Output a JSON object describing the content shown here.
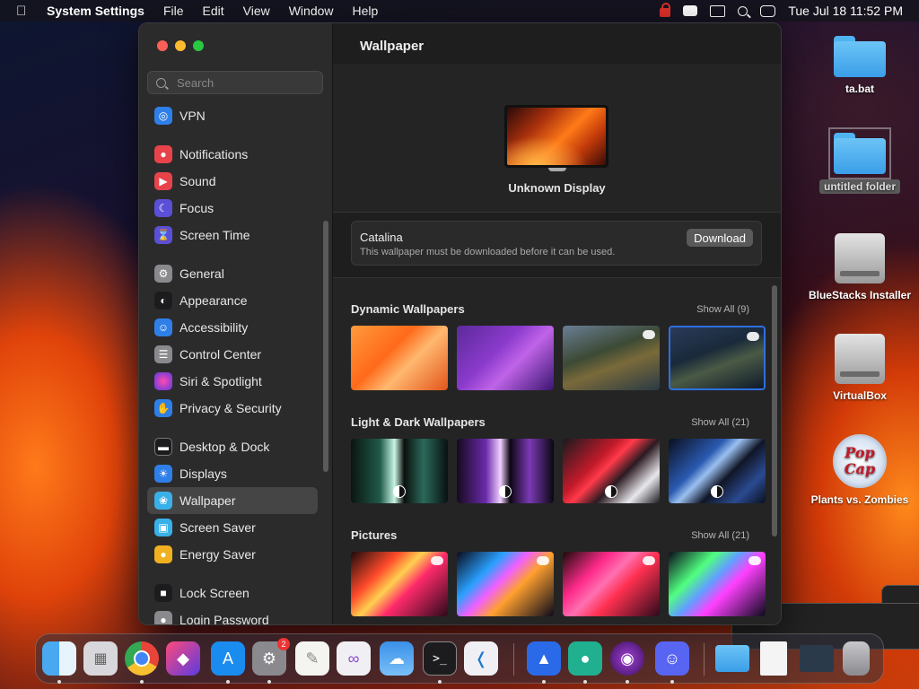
{
  "menubar": {
    "app_name": "System Settings",
    "menus": [
      "File",
      "Edit",
      "View",
      "Window",
      "Help"
    ],
    "clock": "Tue Jul 18  11:52 PM"
  },
  "sidebar": {
    "search_placeholder": "Search",
    "items": [
      {
        "label": "VPN",
        "icon": "globe-icon",
        "color": "#2f7fe8"
      },
      {
        "label": "Notifications",
        "icon": "bell-icon",
        "color": "#e8434a"
      },
      {
        "label": "Sound",
        "icon": "speaker-icon",
        "color": "#e8434a"
      },
      {
        "label": "Focus",
        "icon": "moon-icon",
        "color": "#5a4fd6"
      },
      {
        "label": "Screen Time",
        "icon": "hourglass-icon",
        "color": "#5a4fd6"
      },
      {
        "label": "General",
        "icon": "gear-icon",
        "color": "#8a8a8e"
      },
      {
        "label": "Appearance",
        "icon": "appearance-icon",
        "color": "#1c1c1e"
      },
      {
        "label": "Accessibility",
        "icon": "accessibility-icon",
        "color": "#2f7fe8"
      },
      {
        "label": "Control Center",
        "icon": "control-center-icon",
        "color": "#8a8a8e"
      },
      {
        "label": "Siri & Spotlight",
        "icon": "siri-icon",
        "color": "#c040c0"
      },
      {
        "label": "Privacy & Security",
        "icon": "hand-icon",
        "color": "#2f7fe8"
      },
      {
        "label": "Desktop & Dock",
        "icon": "dock-icon",
        "color": "#1c1c1e"
      },
      {
        "label": "Displays",
        "icon": "sun-icon",
        "color": "#2f7fe8"
      },
      {
        "label": "Wallpaper",
        "icon": "wallpaper-icon",
        "color": "#3ab0e8"
      },
      {
        "label": "Screen Saver",
        "icon": "screensaver-icon",
        "color": "#3ab0e8"
      },
      {
        "label": "Energy Saver",
        "icon": "lightbulb-icon",
        "color": "#f0b020"
      },
      {
        "label": "Lock Screen",
        "icon": "lock-icon",
        "color": "#1c1c1e"
      },
      {
        "label": "Login Password",
        "icon": "key-icon",
        "color": "#8a8a8e"
      }
    ]
  },
  "main": {
    "title": "Wallpaper",
    "display_name": "Unknown Display",
    "catalina": {
      "title": "Catalina",
      "subtitle": "This wallpaper must be downloaded before it can be used.",
      "button": "Download"
    },
    "sections": [
      {
        "title": "Dynamic Wallpapers",
        "show_all": "Show All (9)"
      },
      {
        "title": "Light & Dark Wallpapers",
        "show_all": "Show All (21)"
      },
      {
        "title": "Pictures",
        "show_all": "Show All (21)"
      }
    ]
  },
  "desktop": {
    "items": [
      "ta.bat",
      "untitled folder",
      "BlueStacks Installer",
      "VirtualBox",
      "Plants vs. Zombies"
    ],
    "popcap_text": "Pop Cap"
  },
  "dock": {
    "apps": [
      "Finder",
      "Launchpad",
      "Google Chrome",
      "Shortcuts",
      "App Store",
      "System Settings",
      "TextEdit",
      "Visual Studio",
      "Weather",
      "Terminal",
      "Visual Studio Code",
      "Brave",
      "Keys",
      "Tor",
      "Discord",
      "Downloads",
      "Document",
      "Screen Capture",
      "Trash"
    ],
    "settings_badge": "2"
  }
}
